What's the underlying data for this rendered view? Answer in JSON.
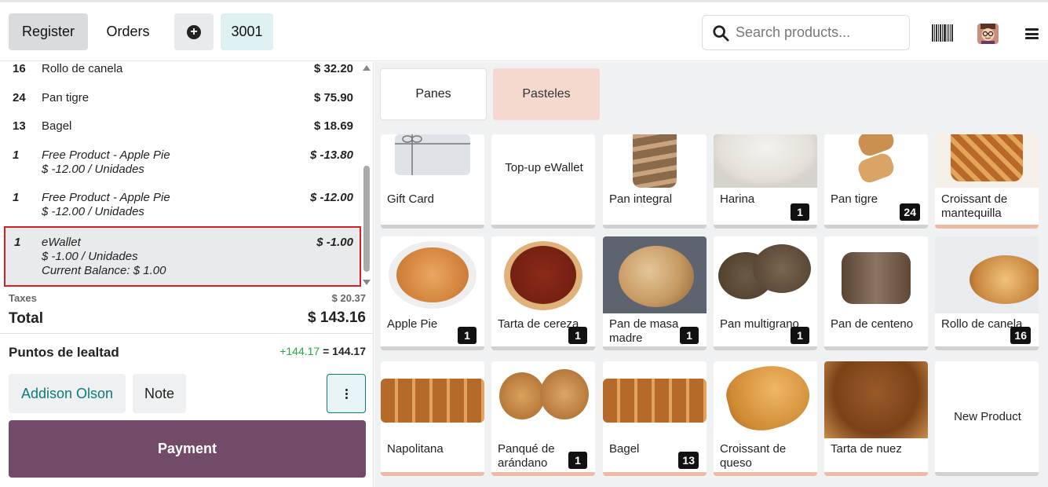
{
  "header": {
    "register_label": "Register",
    "orders_label": "Orders",
    "order_number": "3001",
    "search_placeholder": "Search products..."
  },
  "order_lines": [
    {
      "qty": "16",
      "name": "Rollo de canela",
      "price": "$ 32.20"
    },
    {
      "qty": "24",
      "name": "Pan tigre",
      "price": "$ 75.90"
    },
    {
      "qty": "13",
      "name": "Bagel",
      "price": "$ 18.69"
    },
    {
      "qty": "1",
      "name": "Free Product - Apple Pie",
      "price": "$ -13.80",
      "unit": "$ -12.00 / Unidades"
    },
    {
      "qty": "1",
      "name": "Free Product - Apple Pie",
      "price": "$ -12.00",
      "unit": "$ -12.00 / Unidades"
    },
    {
      "qty": "1",
      "name": "eWallet",
      "price": "$ -1.00",
      "unit": "$ -1.00 / Unidades",
      "balance": "Current Balance: $ 1.00"
    }
  ],
  "totals": {
    "taxes_label": "Taxes",
    "taxes_value": "$ 20.37",
    "total_label": "Total",
    "total_value": "$ 143.16"
  },
  "loyalty": {
    "label": "Puntos de lealtad",
    "added": "+144.17",
    "equals": "=",
    "balance": "144.17"
  },
  "actions": {
    "customer": "Addison Olson",
    "note": "Note",
    "payment": "Payment"
  },
  "categories": [
    {
      "label": "Panes",
      "selected": false
    },
    {
      "label": "Pasteles",
      "selected": true
    }
  ],
  "products": [
    {
      "name": "Gift Card",
      "qty": "",
      "accent": false
    },
    {
      "name": "Top-up eWallet",
      "qty": "",
      "accent": false
    },
    {
      "name": "Pan integral",
      "qty": "",
      "accent": false
    },
    {
      "name": "Harina",
      "qty": "1",
      "accent": false
    },
    {
      "name": "Pan tigre",
      "qty": "24",
      "accent": false
    },
    {
      "name": "Croissant de mantequilla",
      "qty": "",
      "accent": true
    },
    {
      "name": "Apple Pie",
      "qty": "1",
      "accent": false
    },
    {
      "name": "Tarta de cereza",
      "qty": "1",
      "accent": false
    },
    {
      "name": "Pan de masa madre",
      "qty": "1",
      "accent": false
    },
    {
      "name": "Pan multigrano",
      "qty": "1",
      "accent": false
    },
    {
      "name": "Pan de centeno",
      "qty": "",
      "accent": false
    },
    {
      "name": "Rollo de canela",
      "qty": "16",
      "accent": false
    },
    {
      "name": "Napolitana",
      "qty": "",
      "accent": true
    },
    {
      "name": "Panqué de arándano",
      "qty": "1",
      "accent": true
    },
    {
      "name": "Bagel",
      "qty": "13",
      "accent": true
    },
    {
      "name": "Croissant de queso",
      "qty": "",
      "accent": true
    },
    {
      "name": "Tarta de nuez",
      "qty": "",
      "accent": true
    },
    {
      "name": "New Product",
      "qty": "",
      "accent": false
    }
  ],
  "colors": {
    "primary": "#714b67",
    "teal": "#0d7b7b",
    "selected_category": "#f6d9ce",
    "highlight_border": "#d42026",
    "category_bar": "#f0b9a3"
  }
}
